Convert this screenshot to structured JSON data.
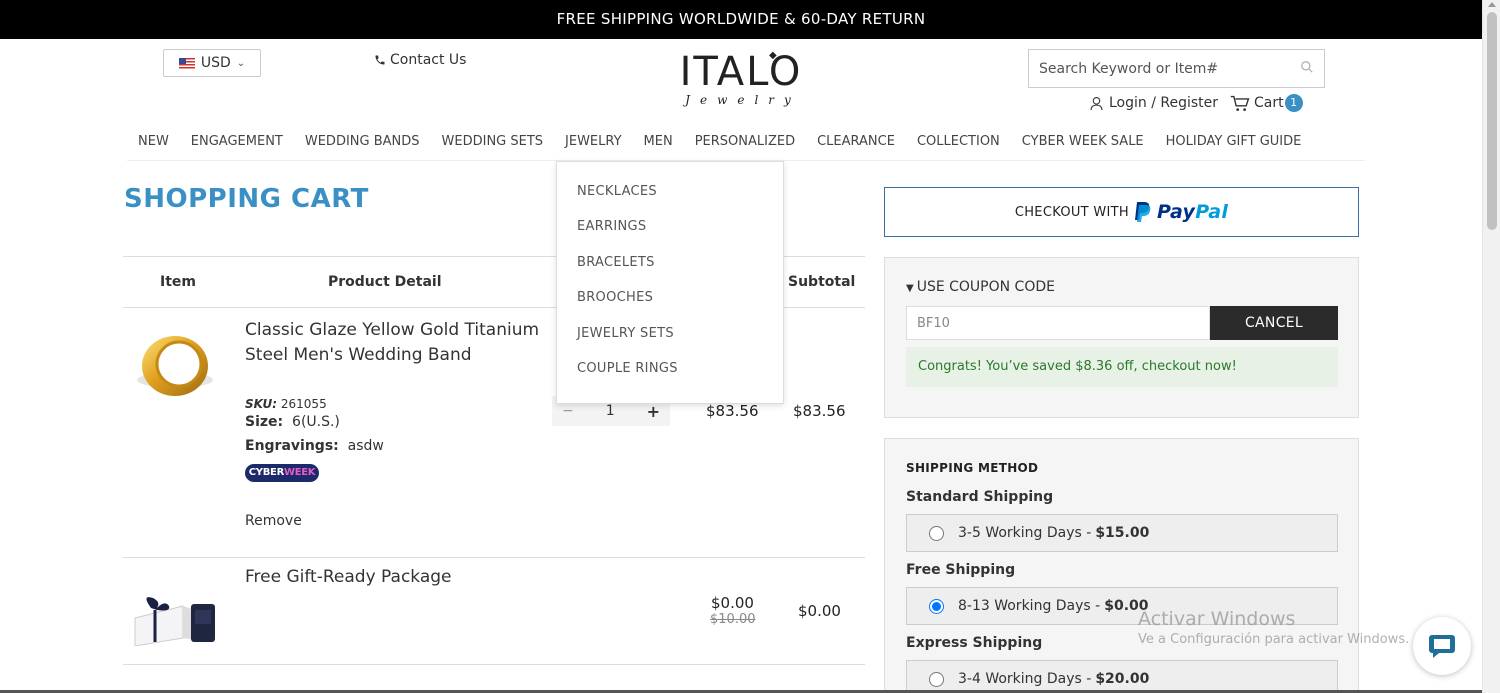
{
  "topbar": {
    "text": "FREE SHIPPING WORLDWIDE & 60-DAY RETURN"
  },
  "header": {
    "currency": "USD",
    "contact": "Contact Us",
    "logo_main": "ITALO",
    "logo_sub": "Jewelry",
    "search_placeholder": "Search Keyword or Item#",
    "login": "Login / Register",
    "cart_label": "Cart",
    "cart_count": "1"
  },
  "nav": {
    "items": [
      "NEW",
      "ENGAGEMENT",
      "WEDDING BANDS",
      "WEDDING SETS",
      "JEWELRY",
      "MEN",
      "PERSONALIZED",
      "CLEARANCE",
      "COLLECTION",
      "CYBER WEEK SALE",
      "HOLIDAY GIFT GUIDE"
    ]
  },
  "dropdown": {
    "items": [
      "NECKLACES",
      "EARRINGS",
      "BRACELETS",
      "BROOCHES",
      "JEWELRY SETS",
      "COUPLE RINGS"
    ]
  },
  "cart": {
    "title": "SHOPPING CART",
    "columns": {
      "item": "Item",
      "detail": "Product Detail",
      "subtotal": "Subtotal"
    },
    "rows": [
      {
        "name": "Classic Glaze Yellow Gold Titanium Steel Men's Wedding Band",
        "sku_label": "SKU:",
        "sku": "261055",
        "size_label": "Size:",
        "size": "6(U.S.)",
        "engr_label": "Engravings:",
        "engraving": "asdw",
        "badge_a": "CYBER",
        "badge_b": "WEEK",
        "remove": "Remove",
        "qty_minus": "−",
        "qty": "1",
        "qty_plus": "+",
        "price": "$83.56",
        "subtotal": "$83.56"
      },
      {
        "name": "Free Gift-Ready Package",
        "price": "$0.00",
        "original_price": "$10.00",
        "subtotal": "$0.00"
      }
    ]
  },
  "paypal": {
    "prefix": "CHECKOUT WITH",
    "pay": "Pay",
    "pal": "Pal"
  },
  "coupon": {
    "heading": "USE COUPON CODE",
    "value": "BF10",
    "cancel": "CANCEL",
    "message": "Congrats! You’ve saved $8.36 off, checkout now!"
  },
  "shipping": {
    "heading": "SHIPPING METHOD",
    "groups": [
      {
        "name": "Standard Shipping",
        "option": "3-5 Working Days -",
        "price": "$15.00",
        "selected": false
      },
      {
        "name": "Free Shipping",
        "option": "8-13 Working Days -",
        "price": "$0.00",
        "selected": true
      },
      {
        "name": "Express Shipping",
        "option": "3-4 Working Days -",
        "price": "$20.00",
        "selected": false
      }
    ]
  },
  "watermark": {
    "line1": "Activar Windows",
    "line2": "Ve a Configuración para activar Windows."
  },
  "colors": {
    "accent": "#3a8fc5",
    "dark": "#2b2b2b",
    "success_bg": "#e7f1e5",
    "success_text": "#2a7a2a"
  }
}
